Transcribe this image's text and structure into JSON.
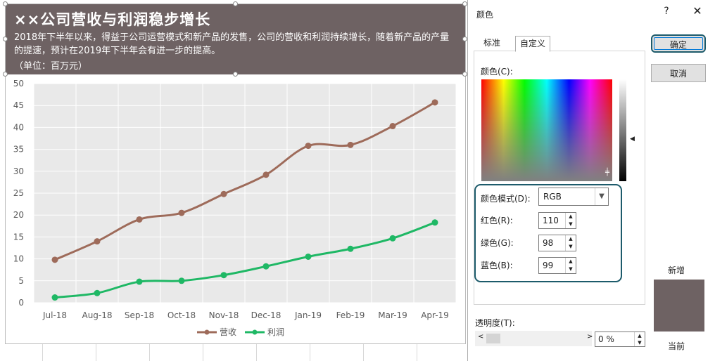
{
  "chart": {
    "title": "××公司营收与利润稳步增长",
    "description": "2018年下半年以来，得益于公司运营模式和新产品的发售，公司的营收和利润持续增长，随着新产品的产量的提速，预计在2019年下半年会有进一步的提高。",
    "unit": "（单位：百万元）",
    "title_bg": "#6e6263"
  },
  "chart_data": {
    "type": "line",
    "categories": [
      "Jul-18",
      "Aug-18",
      "Sep-18",
      "Oct-18",
      "Nov-18",
      "Dec-18",
      "Jan-19",
      "Feb-19",
      "Mar-19",
      "Apr-19"
    ],
    "series": [
      {
        "name": "营收",
        "color": "#9e6b5a",
        "values": [
          9.8,
          14,
          19,
          20.5,
          24.8,
          29.2,
          35.8,
          36,
          40.3,
          45.7
        ]
      },
      {
        "name": "利润",
        "color": "#1fb865",
        "values": [
          1.2,
          2.2,
          4.8,
          5,
          6.3,
          8.3,
          10.5,
          12.3,
          14.7,
          18.3
        ]
      }
    ],
    "ylim": [
      0,
      50
    ],
    "yticks": [
      0,
      5,
      10,
      15,
      20,
      25,
      30,
      35,
      40,
      45,
      50
    ],
    "grid": true,
    "legend": "bottom",
    "plot_bg": "#e9e9e9"
  },
  "dialog": {
    "title": "颜色",
    "help": "?",
    "close": "✕",
    "tabs": [
      "标准",
      "自定义"
    ],
    "colors_label": "颜色(C):",
    "color_mode_label": "颜色模式(D):",
    "color_mode_value": "RGB",
    "red_label": "红色(R):",
    "red_value": "110",
    "green_label": "绿色(G):",
    "green_value": "98",
    "blue_label": "蓝色(B):",
    "blue_value": "99",
    "transparency_label": "透明度(T):",
    "transparency_value": "0 %",
    "ok": "确定",
    "cancel": "取消",
    "new_label": "新增",
    "current_label": "当前",
    "new_color": "#6e6263"
  }
}
